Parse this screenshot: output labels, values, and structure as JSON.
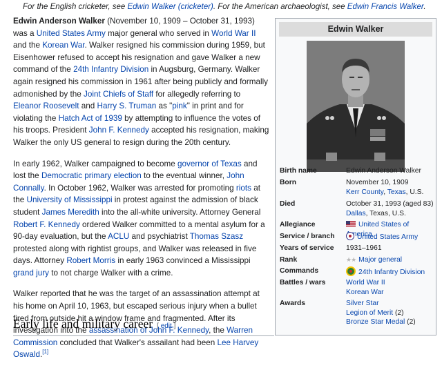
{
  "hatnote": {
    "t1": "For the English cricketer, see ",
    "l1": "Edwin Walker (cricketer)",
    "t2": ". For the American archaeologist, see ",
    "l2": "Edwin Francis Walker",
    "t3": "."
  },
  "p1": {
    "name": "Edwin Anderson Walker",
    "s1": " (November 10, 1909 – October 31, 1993) was a ",
    "l_army": "United States Army",
    "s2": " major general who served in ",
    "l_ww2": "World War II",
    "s3": " and the ",
    "l_korea": "Korean War",
    "s4": ". Walker resigned his commission during 1959, but Eisenhower refused to accept his resignation and gave Walker a new command of the ",
    "l_24": "24th Infantry Division",
    "s5": " in Augsburg, Germany. Walker again resigned his commission in 1961 after being publicly and formally admonished by the ",
    "l_jcs": "Joint Chiefs of Staff",
    "s6": " for allegedly referring to ",
    "l_eleanor": "Eleanor Roosevelt",
    "s7": " and ",
    "l_truman": "Harry S. Truman",
    "s8": " as \"",
    "l_pink": "pink",
    "s9": "\" in print and for violating the ",
    "l_hatch": "Hatch Act of 1939",
    "s10": " by attempting to influence the votes of his troops. President ",
    "l_jfk": "John F. Kennedy",
    "s11": " accepted his resignation, making Walker the only US general to resign during the 20th century."
  },
  "p2": {
    "s1": "In early 1962, Walker campaigned to become ",
    "l_gov": "governor of Texas",
    "s2": " and lost the ",
    "l_dem": "Democratic primary election",
    "s3": " to the eventual winner, ",
    "l_connally": "John Connally",
    "s4": ". In October 1962, Walker was arrested for promoting ",
    "l_riots": "riots",
    "s5": " at the ",
    "l_ums": "University of Mississippi",
    "s6": " in protest against the admission of black student ",
    "l_meredith": "James Meredith",
    "s7": " into the all-white university. Attorney General ",
    "l_rfk": "Robert F. Kennedy",
    "s8": " ordered Walker committed to a mental asylum for a 90-day evaluation, but the ",
    "l_aclu": "ACLU",
    "s9": " and psychiatrist ",
    "l_szasz": "Thomas Szasz",
    "s10": " protested along with rightist groups, and Walker was released in five days. Attorney ",
    "l_morris": "Robert Morris",
    "s11": " in early 1963 convinced a Mississippi ",
    "l_jury": "grand jury",
    "s12": " to not charge Walker with a crime."
  },
  "p3": {
    "s1": "Walker reported that he was the target of an assassination attempt at his home on April 10, 1963, but escaped serious injury when a bullet fired from outside hit a window frame and fragmented. After its investigation into the ",
    "l_assn": "assassination of John F. Kennedy",
    "s2": ", the ",
    "l_warren": "Warren Commission",
    "s3": " concluded that Walker's assailant had been ",
    "l_oswald": "Lee Harvey Oswald",
    "s4": ".",
    "ref": "[1]"
  },
  "section": {
    "title": "Early life and military career",
    "edit_open": "[ ",
    "edit_link": "edit",
    "edit_close": " ]"
  },
  "infobox": {
    "title": "Edwin Walker",
    "rows": {
      "birth_name": {
        "label": "Birth name",
        "value": "Edwin Anderson Walker"
      },
      "born": {
        "label": "Born",
        "date": "November 10, 1909",
        "l_county": "Kerr County",
        "sep": ", ",
        "l_state": "Texas",
        "tail": ", U.S."
      },
      "died": {
        "label": "Died",
        "date": "October 31, 1993 (aged 83)",
        "l_city": "Dallas",
        "tail": ", Texas, U.S."
      },
      "allegiance": {
        "label": "Allegiance",
        "value": "United States of America",
        "icon": "us-flag-icon"
      },
      "service": {
        "label": "Service / branch",
        "value": "United States Army",
        "icon": "army-seal-icon"
      },
      "years": {
        "label": "Years of service",
        "value": "1931–1961"
      },
      "rank": {
        "label": "Rank",
        "value": "Major general",
        "icon": "two-star-insignia-icon"
      },
      "commands": {
        "label": "Commands",
        "value": "24th Infantry Division",
        "icon": "division-patch-icon"
      },
      "battles": {
        "label": "Battles / wars",
        "v1": "World War II",
        "v2": "Korean War"
      },
      "awards": {
        "label": "Awards",
        "v1": "Silver Star",
        "v2": "Legion of Merit",
        "v2_count": " (2)",
        "v3": "Bronze Star Medal",
        "v3_count": " (2)"
      }
    }
  },
  "colors": {
    "link": "#0645ad",
    "text": "#202122",
    "infobox_bg": "#f8f9fa",
    "border": "#a2a9b1",
    "title_bg": "#dcdcdc"
  }
}
